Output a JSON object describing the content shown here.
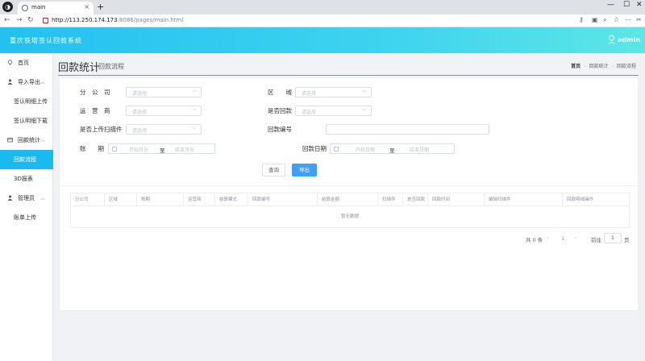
{
  "browser": {
    "tab_title": "main",
    "url_host": "http://113.250.174.173",
    "url_path": ":8086/pages/main.html"
  },
  "header": {
    "app_title": "重庆铁塔签认回款系统",
    "user": "admin"
  },
  "sidebar": {
    "home": "首页",
    "import_export": "导入导出",
    "sub_upload": "签认明细上传",
    "sub_download": "签认明细下载",
    "payment_stats": "回款统计",
    "sub_flow": "回款流程",
    "sub_3d": "3D报表",
    "admin": "管理员",
    "sub_bill": "账单上传"
  },
  "page": {
    "title": "回款统计",
    "subtitle": "回款流程",
    "breadcrumb": [
      "首页",
      "回款统计",
      "回款流程"
    ]
  },
  "form": {
    "branch_label": "分　公　司",
    "region_label": "区　　域",
    "operator_label": "运　营　商",
    "is_paid_label": "是否回款",
    "scan_label": "是否上传扫描件",
    "pay_no_label": "回款编号",
    "period_label": "账　　期",
    "pay_date_label": "回款日期",
    "select_placeholder": "请选择",
    "start_month": "开始月份",
    "end_month": "结束月份",
    "start_date": "开始日期",
    "end_date": "结束日期",
    "to": "至",
    "query_btn": "查询",
    "export_btn": "导出"
  },
  "table": {
    "columns": [
      "分公司",
      "区域",
      "账期",
      "运营商",
      "结算模式",
      "回款编号",
      "结算金额",
      "扫描件",
      "是否回款",
      "回款时间",
      "编辑扫描件",
      "回款明细操作"
    ],
    "empty_text": "暂无数据"
  },
  "pagination": {
    "total": "共 0 条",
    "page": "1",
    "goto": "前往",
    "goto_value": "1",
    "unit": "页"
  }
}
